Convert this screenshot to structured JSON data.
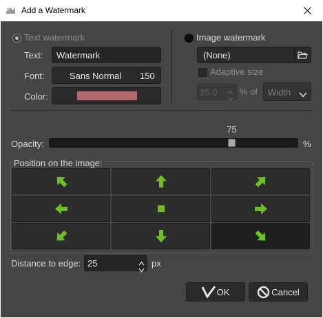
{
  "window": {
    "title": "Add a Watermark"
  },
  "text_watermark": {
    "radio_label": "Text watermark",
    "text_label": "Text:",
    "text_value": "Watermark",
    "font_label": "Font:",
    "font_name": "Sans Normal",
    "font_size": "150",
    "color_label": "Color:",
    "color_value": "#b36a6c"
  },
  "image_watermark": {
    "radio_label": "Image watermark",
    "file_value": "(None)",
    "adaptive_label": "Adaptive size",
    "percent_value": "25.0",
    "percent_label": "% of",
    "dimension_value": "Width"
  },
  "opacity": {
    "label": "Opacity:",
    "value": 75,
    "value_text": "75",
    "unit": "%",
    "fraction": 0.75
  },
  "position": {
    "label": "Position on the image:",
    "selected": "bottom-right",
    "cells": [
      {
        "id": "top-left",
        "icon": "arrow-up-left-icon"
      },
      {
        "id": "top-center",
        "icon": "arrow-up-icon"
      },
      {
        "id": "top-right",
        "icon": "arrow-up-right-icon"
      },
      {
        "id": "middle-left",
        "icon": "arrow-left-icon"
      },
      {
        "id": "center",
        "icon": "square-center-icon"
      },
      {
        "id": "middle-right",
        "icon": "arrow-right-icon"
      },
      {
        "id": "bottom-left",
        "icon": "arrow-down-left-icon"
      },
      {
        "id": "bottom-center",
        "icon": "arrow-down-icon"
      },
      {
        "id": "bottom-right",
        "icon": "arrow-down-right-icon"
      }
    ]
  },
  "distance": {
    "label": "Distance to edge:",
    "value": "25",
    "unit": "px"
  },
  "buttons": {
    "ok_label": "OK",
    "cancel_label": "Cancel"
  },
  "colors": {
    "arrow": "#6cc024",
    "background": "#454545"
  }
}
